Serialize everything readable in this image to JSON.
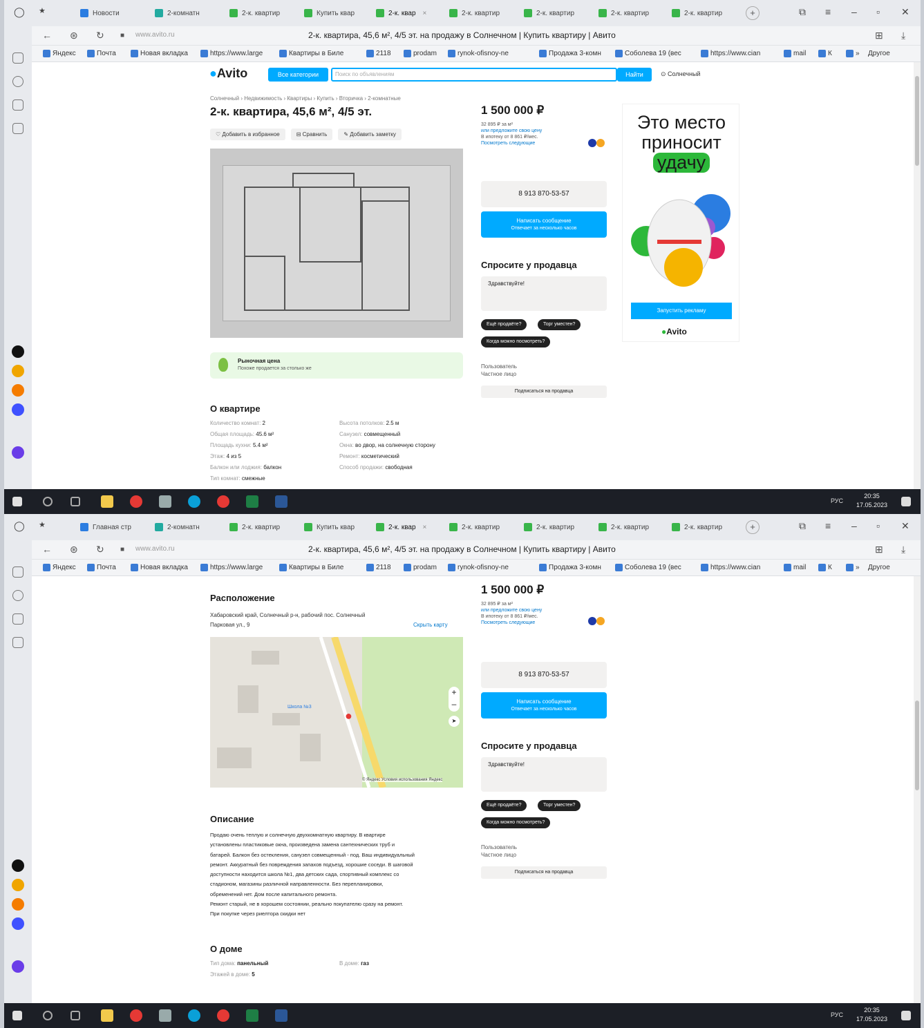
{
  "browser": {
    "tabs_s1": [
      "Новости",
      "2-комнатн",
      "2-к. квартир",
      "Купить квар",
      "2-к. квар",
      "2-к. квартир",
      "2-к. квартир",
      "2-к. квартир",
      "2-к. квартир"
    ],
    "tabs_s2": [
      "Главная стр",
      "2-комнатн",
      "2-к. квартир",
      "Купить квар",
      "2-к. квар",
      "2-к. квартир",
      "2-к. квартир",
      "2-к. квартир",
      "2-к. квартир"
    ],
    "url": "www.avito.ru",
    "page_title": "2-к. квартира, 45,6 м², 4/5 эт. на продажу в Солнечном | Купить квартиру | Авито",
    "bookmarks": [
      "Яндекс",
      "Почта",
      "Новая вкладка",
      "https://www.large",
      "Квартиры в Биле",
      "2118",
      "prodam",
      "rynok-ofisnoy-ne",
      "Продажа 3-комн",
      "Соболева 19 (вес",
      "https://www.cian",
      "mail",
      "К",
      "»"
    ],
    "bookmarks_other": "Другое",
    "clock_time": "20:35",
    "clock_date": "17.05.2023",
    "lang": "РУС"
  },
  "avito": {
    "logo": "Avito",
    "categories_btn": "Все категории",
    "search_placeholder": "Поиск по объявлениям",
    "find_btn": "Найти",
    "location": "Солнечный",
    "breadcrumbs": "Солнечный › Недвижимость › Квартиры › Купить › Вторичка › 2-комнатные",
    "title": "2-к. квартира, 45,6 м², 4/5 эт.",
    "action_fav": "Добавить в избранное",
    "action_compare": "Сравнить",
    "action_note": "Добавить заметку",
    "market_title": "Рыночная цена",
    "market_sub": "Похоже продается за столько же",
    "about_title": "О квартире",
    "about_left": [
      {
        "k": "Количество комнат:",
        "v": "2"
      },
      {
        "k": "Общая площадь:",
        "v": "45.6 м²"
      },
      {
        "k": "Площадь кухни:",
        "v": "5.4 м²"
      },
      {
        "k": "Этаж:",
        "v": "4 из 5"
      },
      {
        "k": "Балкон или лоджия:",
        "v": "балкон"
      },
      {
        "k": "Тип комнат:",
        "v": "смежные"
      }
    ],
    "about_right": [
      {
        "k": "Высота потолков:",
        "v": "2.5 м"
      },
      {
        "k": "Санузел:",
        "v": "совмещенный"
      },
      {
        "k": "Окна:",
        "v": "во двор, на солнечную сторону"
      },
      {
        "k": "Ремонт:",
        "v": "косметический"
      },
      {
        "k": "Способ продажи:",
        "v": "свободная"
      }
    ],
    "price": "1 500 000 ₽",
    "price_per_m": "32 895 ₽ за м²",
    "price_offer": "или предложите свою цену",
    "mortgage": "В ипотеку от 8 861 ₽/мес.",
    "mortgage_link": "Посмотреть следующие",
    "phone": "8 913 870-53-57",
    "write_btn": "Написать сообщение",
    "write_sub": "Отвечает за несколько часов",
    "ask_title": "Спросите у продавца",
    "ask_placeholder": "Здравствуйте!",
    "chip1": "Ещё продаёте?",
    "chip2": "Торг уместен?",
    "chip3": "Когда можно посмотреть?",
    "seller_type": "Пользователь",
    "seller_name": "Частное лицо",
    "subscribe": "Подписаться на продавца",
    "ad_line1": "Это место",
    "ad_line2": "приносит",
    "ad_line3": "удачу",
    "ad_btn": "Запустить рекламу",
    "location_title": "Расположение",
    "address1": "Хабаровский край, Солнечный р-н, рабочий пос. Солнечный",
    "address2": "Парковая ул., 9",
    "show_map": "Скрыть карту",
    "map_label": "Школа №3",
    "map_attribution": "© Яндекс Условия использования Яндекс",
    "desc_title": "Описание",
    "desc_lines": [
      "Продаю очень теплую и солнечную двухкомнатную квартиру. В квартире",
      "установлены пластиковые окна, произведена замена сантехнических труб и",
      "батарей. Балкон без остекления, санузел совмещенный - под. Ваш индивидуальный",
      "ремонт. Аккуратный без повреждения запахов подъезд, хорошие соседи. В шаговой",
      "доступности находится школа №1, два детских сада, спортивный комплекс со",
      "стадионом, магазины различной направленности. Без перепланировки,",
      "обременений нет. Дом после капитального ремонта.",
      "Ремонт старый, не в хорошем состоянии, реально покупателю сразу на ремонт.",
      "При покупке через риелтора скидки нет"
    ],
    "house_title": "О доме",
    "house_type_k": "Тип дома:",
    "house_type_v": "панельный",
    "house_floors_k": "Этажей в доме:",
    "house_floors_v": "5",
    "house_extra_k": "В доме:",
    "house_extra_v": "газ"
  }
}
